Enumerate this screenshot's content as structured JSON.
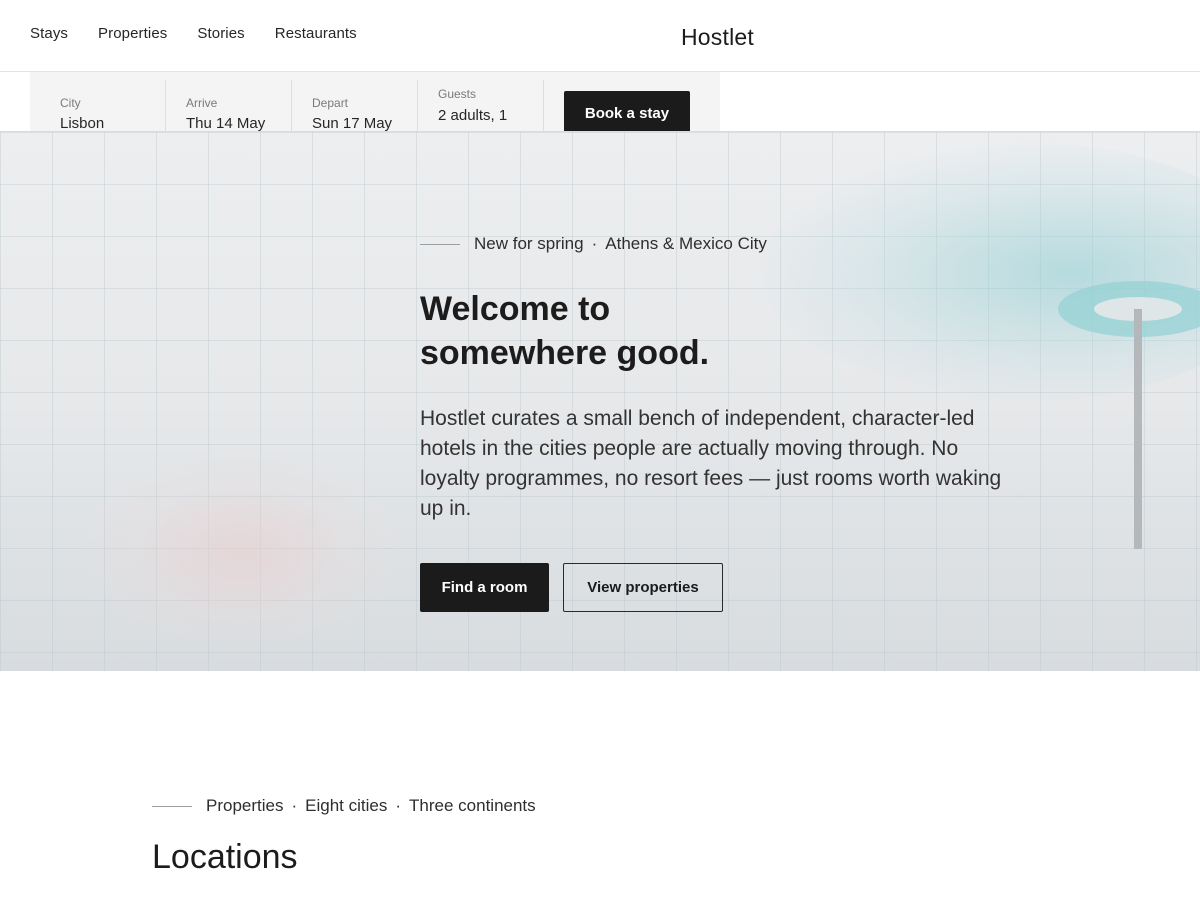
{
  "header": {
    "nav": [
      "Stays",
      "Properties",
      "Stories",
      "Restaurants"
    ],
    "brand": "Hostlet"
  },
  "booking": {
    "city": {
      "label": "City",
      "value": "Lisbon"
    },
    "arrive": {
      "label": "Arrive",
      "value": "Thu 14 May"
    },
    "depart": {
      "label": "Depart",
      "value": "Sun 17 May"
    },
    "guests": {
      "label": "Guests",
      "value": "2 adults, 1"
    },
    "cta": "Book a stay"
  },
  "hero": {
    "eyebrow_a": "New for spring",
    "eyebrow_sep": "·",
    "eyebrow_b": "Athens & Mexico City",
    "title_line1": "Welcome to",
    "title_line2": "somewhere good.",
    "description": "Hostlet curates a small bench of independent, character-led hotels in the cities people are actually moving through. No loyalty programmes, no resort fees — just rooms worth waking up in.",
    "primary_cta": "Find a room",
    "secondary_cta": "View properties"
  },
  "locations": {
    "eyebrow_a": "Properties",
    "eyebrow_b": "Eight cities",
    "eyebrow_c": "Three continents",
    "sep": "·",
    "title": "Locations"
  }
}
